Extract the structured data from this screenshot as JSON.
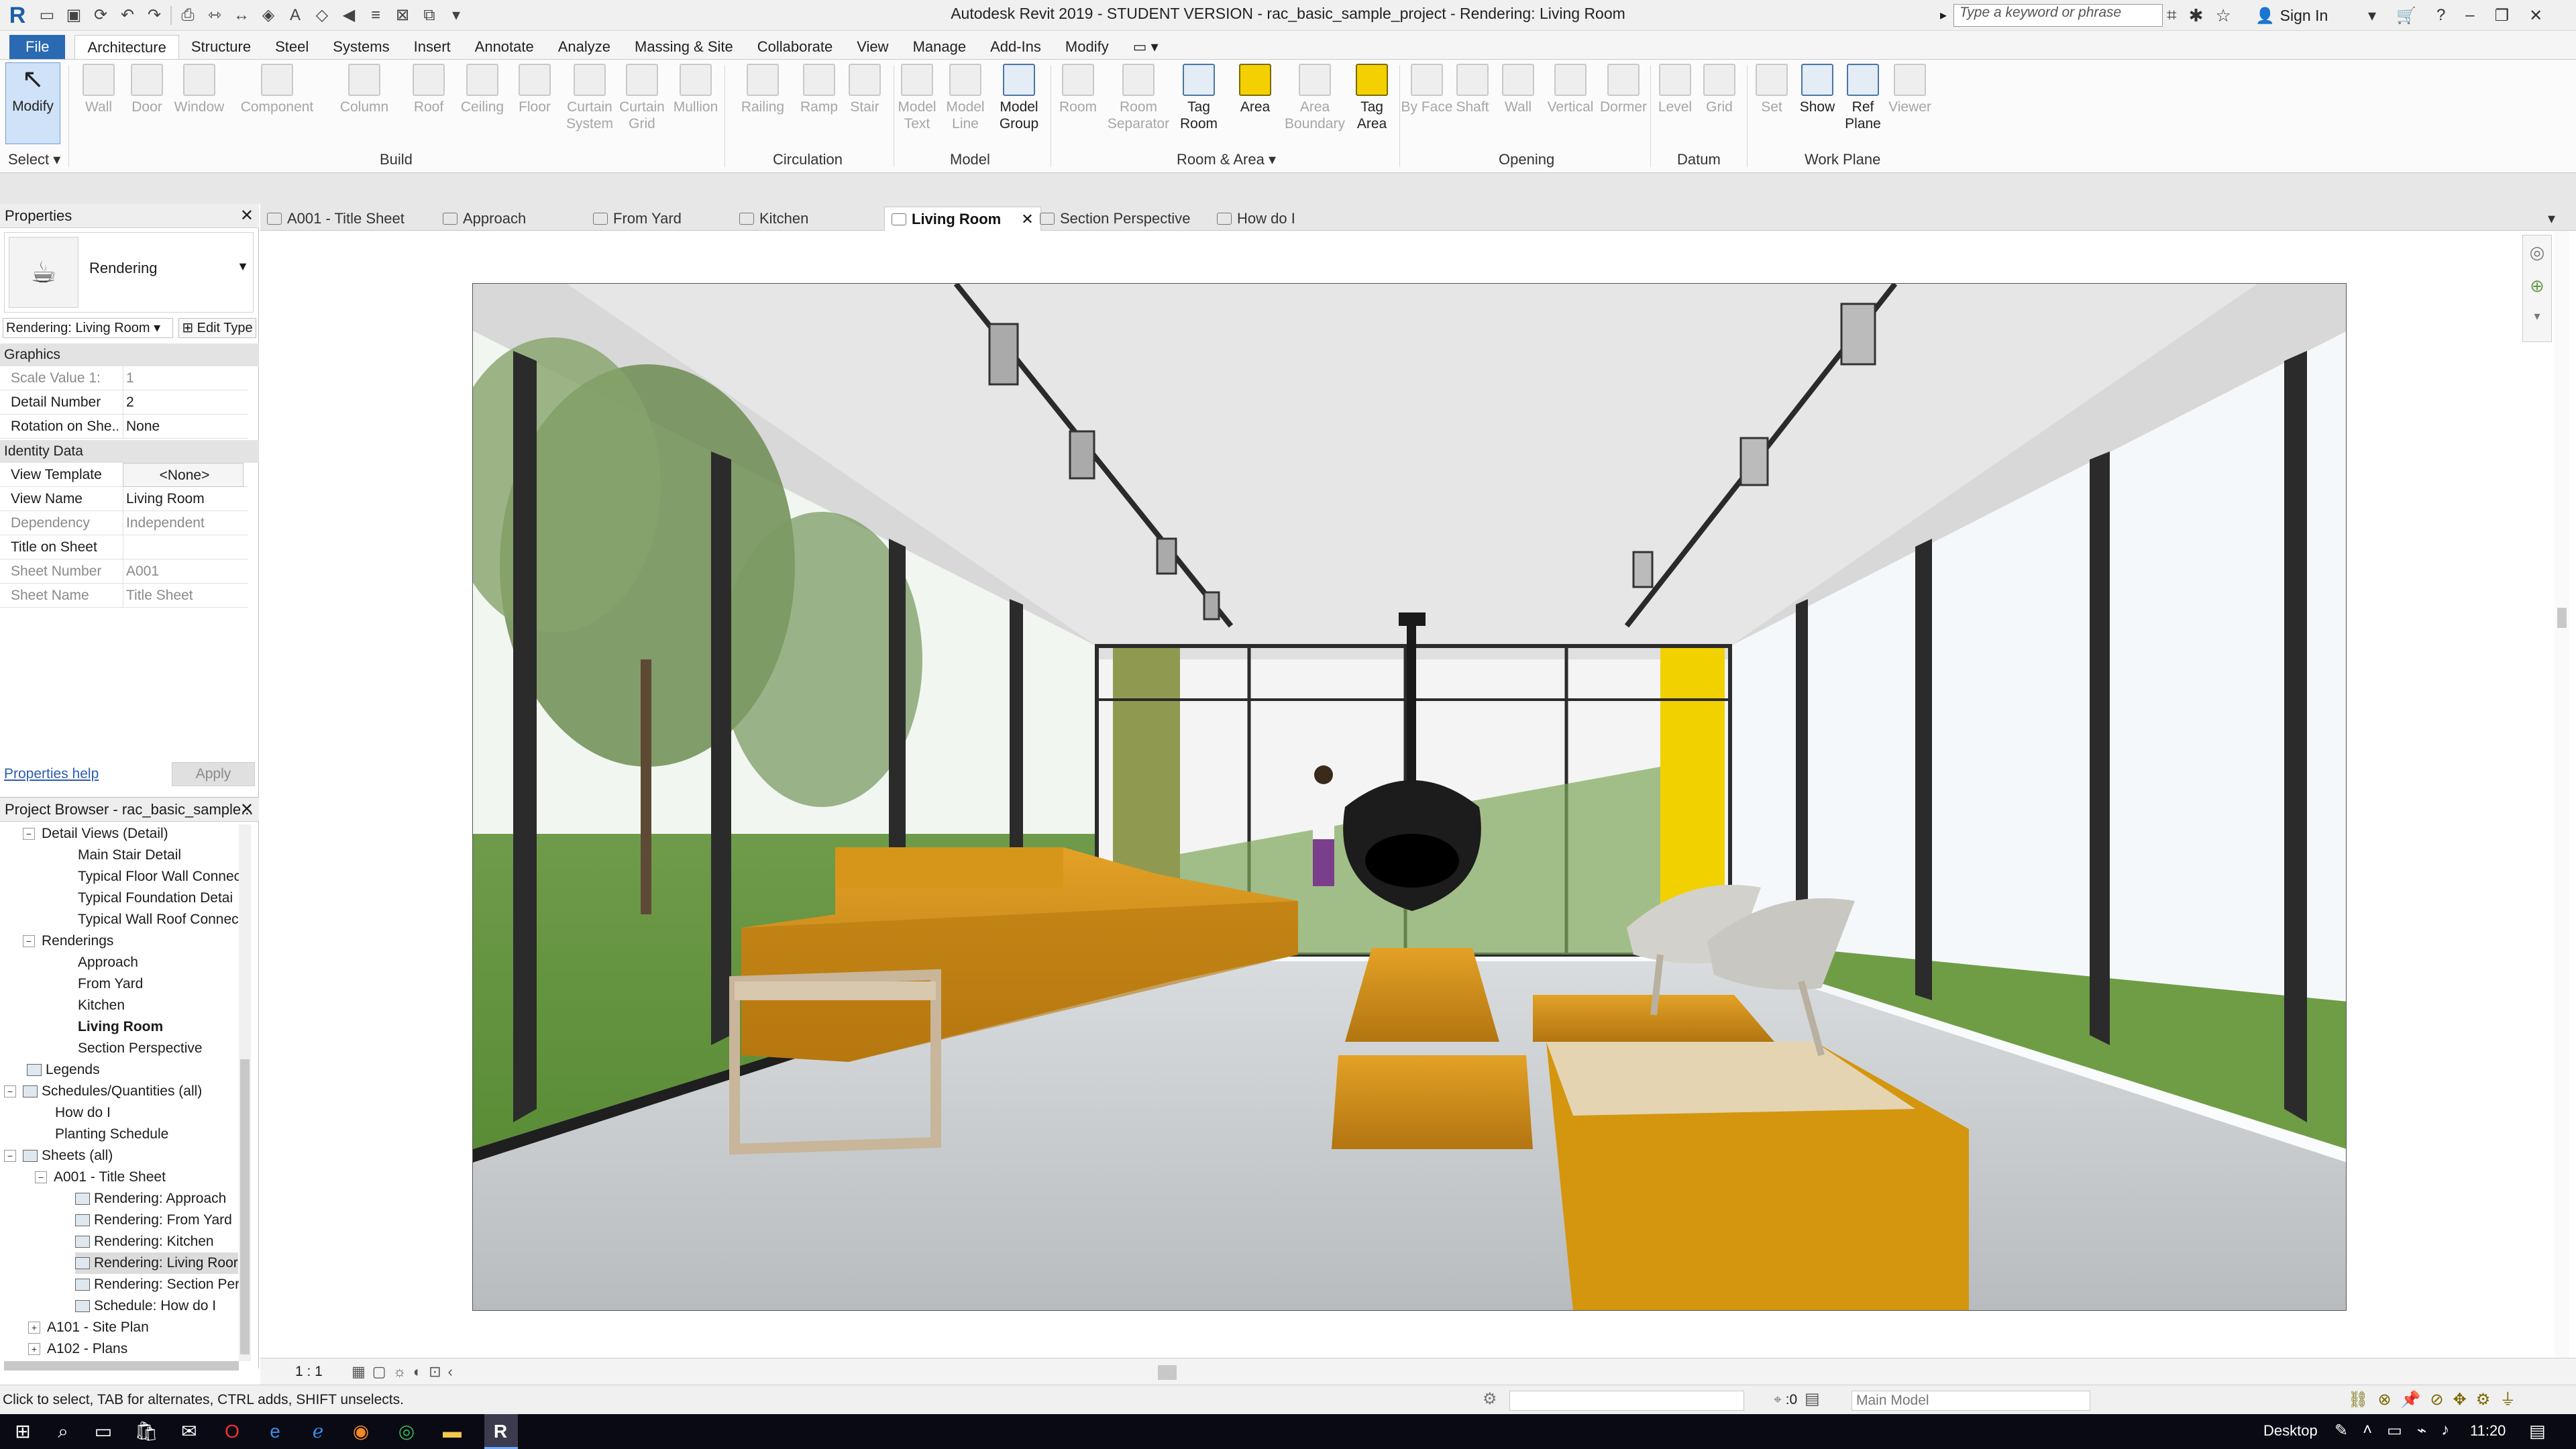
{
  "window": {
    "title": "Autodesk Revit 2019 - STUDENT VERSION - rac_basic_sample_project - Rendering: Living Room",
    "search_placeholder": "Type a keyword or phrase",
    "sign_in": "Sign In"
  },
  "ribbon_tabs": [
    "File",
    "Architecture",
    "Structure",
    "Steel",
    "Systems",
    "Insert",
    "Annotate",
    "Analyze",
    "Massing & Site",
    "Collaborate",
    "View",
    "Manage",
    "Add-Ins",
    "Modify"
  ],
  "ribbon": {
    "select": {
      "modify": "Modify",
      "select_label": "Select"
    },
    "build": {
      "label": "Build",
      "tools": [
        "Wall",
        "Door",
        "Window",
        "Component",
        "Column",
        "Roof",
        "Ceiling",
        "Floor",
        "Curtain System",
        "Curtain Grid",
        "Mullion"
      ]
    },
    "circulation": {
      "label": "Circulation",
      "tools": [
        "Railing",
        "Ramp",
        "Stair"
      ]
    },
    "model": {
      "label": "Model",
      "tools": [
        "Model Text",
        "Model Line",
        "Model Group"
      ]
    },
    "room_area": {
      "label": "Room & Area",
      "tools": [
        "Room",
        "Room Separator",
        "Tag Room",
        "Area",
        "Area Boundary",
        "Tag Area"
      ]
    },
    "opening": {
      "label": "Opening",
      "tools": [
        "By Face",
        "Shaft",
        "Wall",
        "Vertical",
        "Dormer"
      ]
    },
    "datum": {
      "label": "Datum",
      "tools": [
        "Level",
        "Grid"
      ]
    },
    "work_plane": {
      "label": "Work Plane",
      "tools": [
        "Set",
        "Show",
        "Ref Plane",
        "Viewer"
      ]
    }
  },
  "properties": {
    "title": "Properties",
    "type_name": "Rendering",
    "instance": "Rendering: Living Room",
    "edit_type": "Edit Type",
    "sections": {
      "graphics": "Graphics",
      "identity": "Identity Data"
    },
    "graphics_rows": [
      {
        "k": "Scale Value    1:",
        "v": "1"
      },
      {
        "k": "Detail Number",
        "v": "2"
      },
      {
        "k": "Rotation on She...",
        "v": "None"
      }
    ],
    "identity_rows": [
      {
        "k": "View Template",
        "v": "<None>"
      },
      {
        "k": "View Name",
        "v": "Living Room"
      },
      {
        "k": "Dependency",
        "v": "Independent"
      },
      {
        "k": "Title on Sheet",
        "v": ""
      },
      {
        "k": "Sheet Number",
        "v": "A001"
      },
      {
        "k": "Sheet Name",
        "v": "Title Sheet"
      }
    ],
    "help": "Properties help",
    "apply": "Apply"
  },
  "browser": {
    "title": "Project Browser - rac_basic_sample...",
    "items": [
      "Detail Views (Detail)",
      "Main Stair Detail",
      "Typical Floor Wall Connec",
      "Typical Foundation Detai",
      "Typical Wall Roof Connec",
      "Renderings",
      "Approach",
      "From Yard",
      "Kitchen",
      "Living Room",
      "Section Perspective",
      "Legends",
      "Schedules/Quantities (all)",
      "How do I",
      "Planting Schedule",
      "Sheets (all)",
      "A001 - Title Sheet",
      "Rendering: Approach",
      "Rendering: From Yard",
      "Rendering: Kitchen",
      "Rendering: Living Roor",
      "Rendering: Section Per",
      "Schedule: How do I",
      "A101 - Site Plan",
      "A102 - Plans"
    ]
  },
  "view_tabs": [
    "A001 - Title Sheet",
    "Approach",
    "From Yard",
    "Kitchen",
    "Living Room",
    "Section Perspective",
    "How do I"
  ],
  "viewbar": {
    "scale": "1 : 1"
  },
  "status": {
    "hint": "Click to select, TAB for alternates, CTRL adds, SHIFT unselects.",
    "zero": ":0",
    "model": "Main Model"
  },
  "taskbar": {
    "desktop": "Desktop",
    "time": "11:20"
  },
  "colors": {
    "file_tab": "#2a6ab2",
    "sofa": "#c88a14",
    "accent_yellow": "#f5d000"
  }
}
